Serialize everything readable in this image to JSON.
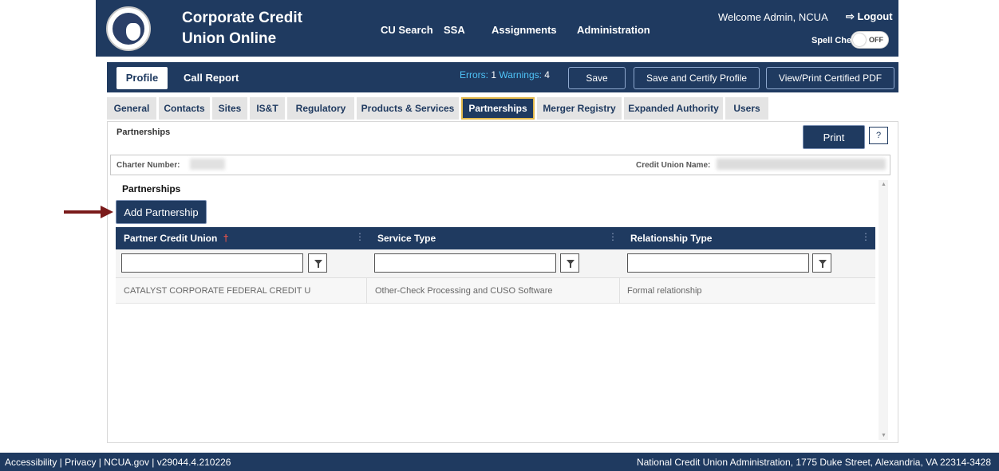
{
  "header": {
    "title": "Corporate Credit Union Online",
    "nav": [
      "CU Search",
      "SSA",
      "Assignments",
      "Administration"
    ],
    "welcome": "Welcome Admin, NCUA",
    "logout": "Logout",
    "spellcheck_label": "Spell Check",
    "spellcheck_state": "OFF"
  },
  "profile_bar": {
    "tabs": [
      "Profile",
      "Call Report"
    ],
    "errors_label": "Errors:",
    "errors_count": "1",
    "warnings_label": "Warnings:",
    "warnings_count": "4",
    "buttons": [
      "Save",
      "Save and Certify Profile",
      "View/Print Certified PDF"
    ]
  },
  "subtabs": [
    "General",
    "Contacts",
    "Sites",
    "IS&T",
    "Regulatory",
    "Products & Services",
    "Partnerships",
    "Merger Registry",
    "Expanded Authority",
    "Users"
  ],
  "active_subtab": "Partnerships",
  "content": {
    "section_label": "Partnerships",
    "print_label": "Print",
    "help_label": "?",
    "charter_label": "Charter Number:",
    "cu_name_label": "Credit Union Name:",
    "heading": "Partnerships",
    "add_button": "Add Partnership"
  },
  "grid": {
    "columns": [
      "Partner Credit Union",
      "Service Type",
      "Relationship Type"
    ],
    "required_marker": "†",
    "column_menu": "⋮",
    "rows": [
      [
        "CATALYST CORPORATE FEDERAL CREDIT U",
        "Other-Check Processing and CUSO Software",
        "Formal relationship"
      ]
    ]
  },
  "footer": {
    "links": "Accessibility | Privacy | NCUA.gov | v29044.4.210226",
    "address": "National Credit Union Administration, 1775 Duke Street, Alexandria, VA 22314-3428"
  },
  "colors": {
    "navy": "#1f3a60",
    "active_tab_border": "#e2b84b",
    "warnings_text": "#4fc3f7",
    "arrow": "#7a1a1a"
  },
  "icons": [
    "ncua-seal-logo",
    "logout-icon",
    "filter-icon",
    "annotation-arrow-icon"
  ]
}
